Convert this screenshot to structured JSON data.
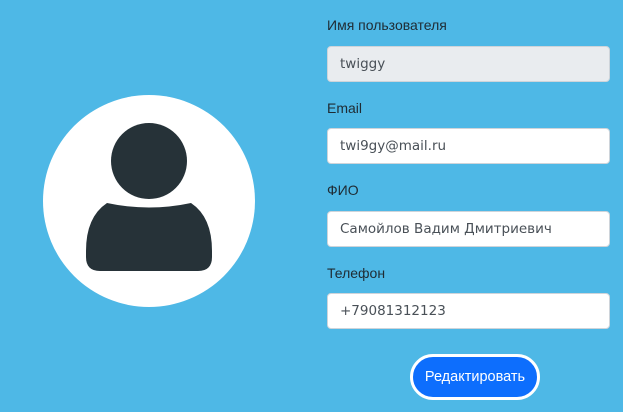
{
  "profile": {
    "avatar_icon": "user-silhouette-icon",
    "colors": {
      "background": "#4eb8e6",
      "avatar_circle": "#ffffff",
      "avatar_figure": "#263238",
      "button": "#0d6efd"
    }
  },
  "form": {
    "username": {
      "label": "Имя пользователя",
      "value": "twiggy",
      "readonly": true
    },
    "email": {
      "label": "Email",
      "value": "twi9gy@mail.ru"
    },
    "full_name": {
      "label": "ФИО",
      "value": "Самойлов Вадим Дмитриевич"
    },
    "phone": {
      "label": "Телефон",
      "value": "+79081312123"
    },
    "edit_button_label": "Редактировать"
  }
}
